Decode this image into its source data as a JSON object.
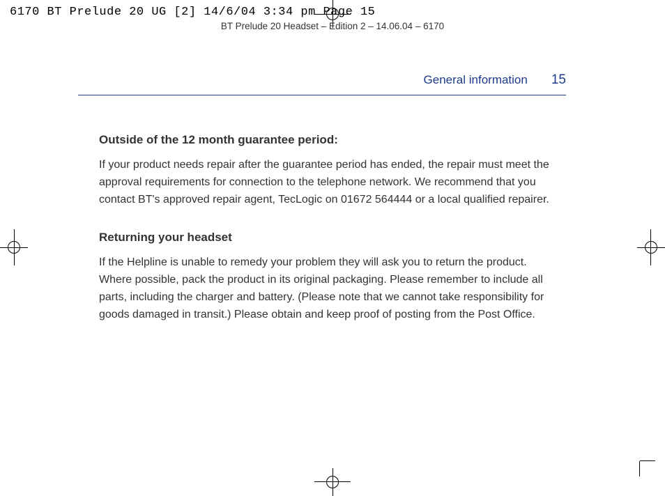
{
  "slugline": "6170 BT Prelude 20 UG [2]  14/6/04  3:34 pm  Page 15",
  "docline": "BT Prelude 20 Headset – Edition 2 – 14.06.04 – 6170",
  "running_head": {
    "section": "General information",
    "page": "15"
  },
  "blocks": [
    {
      "type": "subhead",
      "text": "Outside of the 12 month guarantee period:"
    },
    {
      "type": "para",
      "text": "If your product needs repair after the guarantee period has ended, the repair must meet the approval requirements for connection to the telephone network. We recommend that you contact BT's approved repair agent, TecLogic on 01672 564444 or a local qualified repairer."
    },
    {
      "type": "subhead",
      "text": "Returning your headset"
    },
    {
      "type": "para",
      "text": "If the Helpline is unable to remedy your problem they will ask you to return the product. Where possible, pack the product in its original packaging. Please remember to include all parts, including the charger and battery. (Please note that we cannot take responsibility for goods damaged in transit.) Please obtain and keep proof of posting from the Post Office."
    }
  ]
}
